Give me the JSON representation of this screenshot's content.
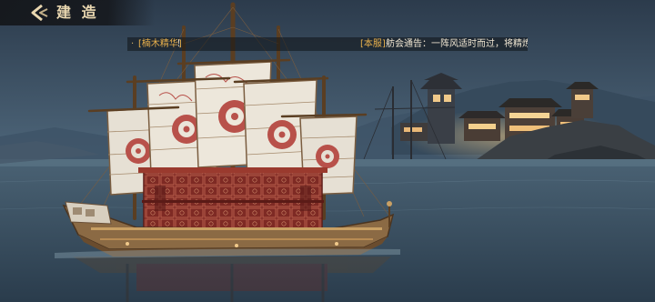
{
  "header": {
    "back_icon": "chevron-left-icon",
    "title": "建 造"
  },
  "ticker": {
    "bullet": "·",
    "item_name": "[楠木精华]",
    "item_suffix": "！",
    "server_tag": "[本服]",
    "message": "舫会通告：一阵风适时而过，将精炼师"
  },
  "colors": {
    "title": "#e9d7b0",
    "highlight": "#e8b04c",
    "sail": "#e8e2d6",
    "sail_pattern": "#b8514a",
    "hull": "#8b6a44",
    "cabin": "#8a2f28"
  }
}
